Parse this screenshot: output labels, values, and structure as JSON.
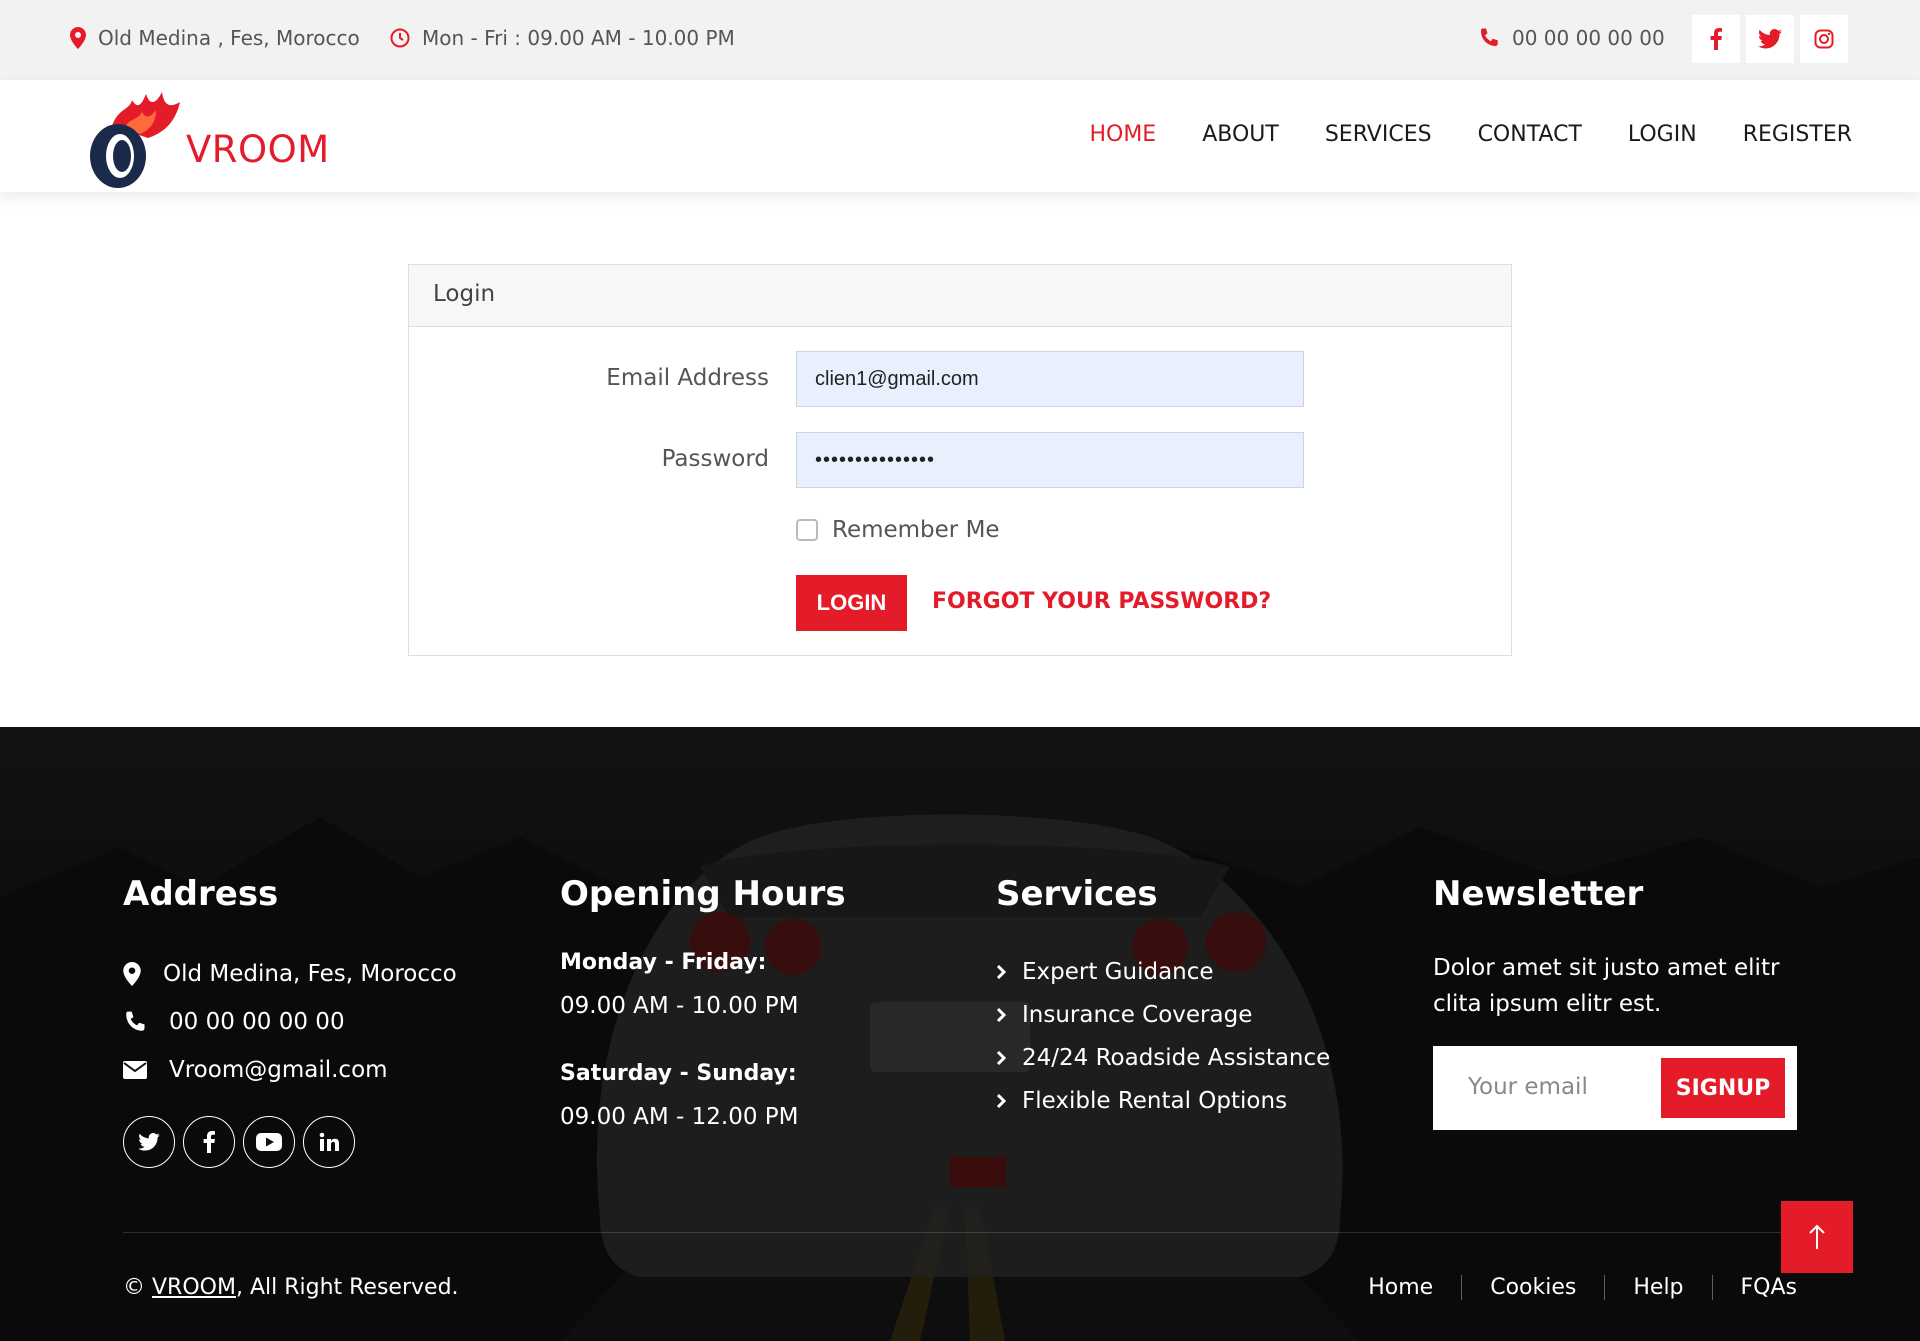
{
  "topbar": {
    "location": "Old Medina , Fes, Morocco",
    "hours": "Mon - Fri : 09.00 AM - 10.00 PM",
    "phone": "00 00 00 00 00",
    "social_icons": [
      "facebook-icon",
      "twitter-icon",
      "instagram-icon"
    ]
  },
  "nav": {
    "logo_text": "VROOM",
    "links": [
      "HOME",
      "ABOUT",
      "SERVICES",
      "CONTACT",
      "LOGIN",
      "REGISTER"
    ],
    "active": "HOME"
  },
  "login": {
    "header": "Login",
    "email_label": "Email Address",
    "email_value": "clien1@gmail.com",
    "password_label": "Password",
    "password_value": "•••••••••••••••",
    "remember_label": "Remember Me",
    "remember_checked": false,
    "login_button": "LOGIN",
    "forgot_link": "FORGOT YOUR PASSWORD?"
  },
  "footer": {
    "address": {
      "title": "Address",
      "location": "Old Medina, Fes, Morocco",
      "phone": "00 00 00 00 00",
      "email": "Vroom@gmail.com",
      "social_icons": [
        "twitter-icon",
        "facebook-icon",
        "youtube-icon",
        "linkedin-icon"
      ]
    },
    "hours": {
      "title": "Opening Hours",
      "weekday_label": "Monday - Friday:",
      "weekday_time": "09.00 AM - 10.00 PM",
      "weekend_label": "Saturday - Sunday:",
      "weekend_time": "09.00 AM - 12.00 PM"
    },
    "services": {
      "title": "Services",
      "items": [
        "Expert Guidance",
        "Insurance Coverage",
        "24/24 Roadside Assistance",
        "Flexible Rental Options"
      ]
    },
    "newsletter": {
      "title": "Newsletter",
      "text": "Dolor amet sit justo amet elitr clita ipsum elitr est.",
      "placeholder": "Your email",
      "button": "SIGNUP"
    },
    "copyright_prefix": "©",
    "copyright_brand": "VROOM",
    "copyright_suffix": ", All Right Reserved.",
    "bottom_links": [
      "Home",
      "Cookies",
      "Help",
      "FQAs"
    ]
  },
  "colors": {
    "accent": "#e41c2a",
    "navy": "#1b2a4a",
    "topbar_bg": "#f2f2f2",
    "footer_bg": "#0d0d0d"
  }
}
